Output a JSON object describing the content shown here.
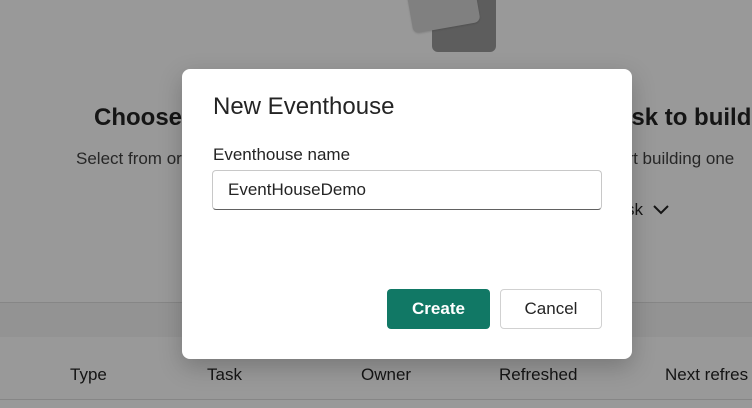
{
  "background": {
    "heading_left": "Choose",
    "heading_right": "ask to build",
    "sub_left": "Select from or",
    "sub_right": "art building one",
    "task_filter": "sk",
    "table_headers": [
      "Type",
      "Task",
      "Owner",
      "Refreshed",
      "Next refres"
    ]
  },
  "dialog": {
    "title": "New Eventhouse",
    "field_label": "Eventhouse name",
    "field_value": "EventHouseDemo",
    "create_label": "Create",
    "cancel_label": "Cancel"
  },
  "colors": {
    "primary_button": "#117865",
    "overlay": "rgba(0,0,0,0.40)"
  },
  "icons": {
    "task_filter": "chevron-down-icon"
  }
}
